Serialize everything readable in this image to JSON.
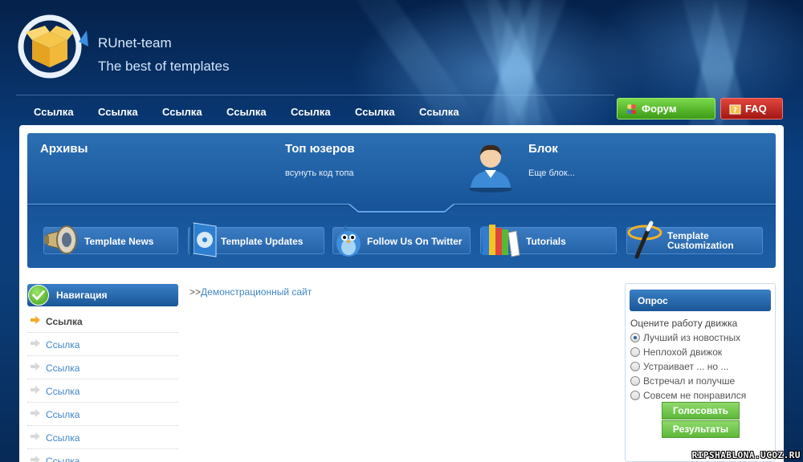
{
  "header": {
    "site_name": "RUnet-team",
    "slogan": "The best of templates"
  },
  "topnav": {
    "links": [
      "Ссылка",
      "Ссылка",
      "Ссылка",
      "Ссылка",
      "Ссылка",
      "Ссылка",
      "Ссылка"
    ],
    "forum_label": "Форум",
    "faq_label": "FAQ"
  },
  "panel": {
    "archives_title": "Архивы",
    "top_users_title": "Топ юзеров",
    "top_users_text": "всунуть код топа",
    "block_title": "Блок",
    "block_text": "Еще блок..."
  },
  "features": [
    {
      "label": "Template News",
      "icon": "megaphone-icon"
    },
    {
      "label": "Template Updates",
      "icon": "cd-box-icon"
    },
    {
      "label": "Follow Us On Twitter",
      "icon": "twitter-bird-icon"
    },
    {
      "label": "Tutorials",
      "icon": "books-icon"
    },
    {
      "label_line1": "Template",
      "label_line2": "Customization",
      "icon": "magic-wand-icon"
    }
  ],
  "navigation": {
    "title": "Навигация",
    "items": [
      "Ссылка",
      "Ссылка",
      "Ссылка",
      "Ссылка",
      "Ссылка",
      "Ссылка",
      "Ссылка"
    ]
  },
  "breadcrumb": {
    "prefix": ">>",
    "link": "Демонстрационный сайт"
  },
  "poll": {
    "title": "Опрос",
    "question": "Оцените работу движка",
    "options": [
      "Лучший из новостных",
      "Неплохой движок",
      "Устраивает ... но ...",
      "Встречал и получше",
      "Совсем не понравился"
    ],
    "vote_label": "Голосовать",
    "results_label": "Результаты"
  },
  "watermark": "RIPSHABLONA.UCOZ.RU",
  "colors": {
    "accent_blue": "#1a5697",
    "link_blue": "#3f86c7",
    "forum_green": "#3c9a17",
    "faq_red": "#a11812"
  }
}
